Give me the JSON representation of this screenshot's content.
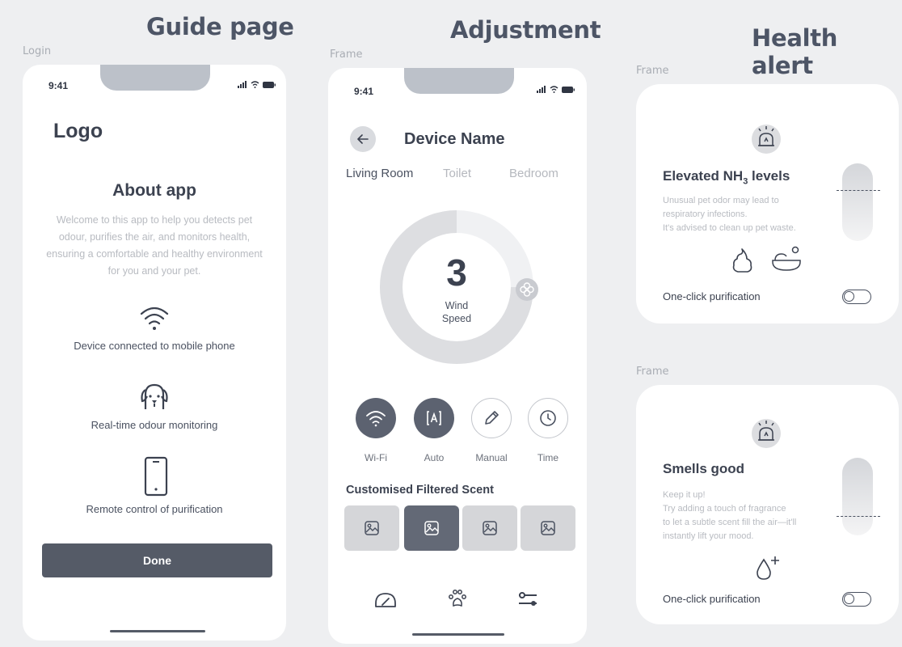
{
  "sections": {
    "guide_title": "Guide page",
    "adjust_title": "Adjustment",
    "health_title": "Health alert"
  },
  "frame_labels": {
    "login": "Login",
    "frame1": "Frame",
    "frame2": "Frame",
    "frame3": "Frame"
  },
  "guide": {
    "time": "9:41",
    "logo": "Logo",
    "about_title": "About app",
    "about_text": "Welcome to this app to help you detects pet odour, purifies the air, and monitors health, ensuring a comfortable and healthy environment for you and your pet.",
    "features": [
      {
        "icon": "wifi-icon",
        "label": "Device connected to mobile phone"
      },
      {
        "icon": "dog-face-icon",
        "label": "Real-time odour monitoring"
      },
      {
        "icon": "phone-icon",
        "label": "Remote control of purification"
      }
    ],
    "done_label": "Done"
  },
  "adjust": {
    "time": "9:41",
    "device_name": "Device Name",
    "rooms": [
      "Living Room",
      "Toilet",
      "Bedroom"
    ],
    "wind_speed_value": "3",
    "wind_label_line1": "Wind",
    "wind_label_line2": "Speed",
    "modes": [
      {
        "label": "Wi-Fi",
        "icon": "wifi-icon",
        "active": true
      },
      {
        "label": "Auto",
        "icon": "auto-icon",
        "active": true
      },
      {
        "label": "Manual",
        "icon": "pencil-icon",
        "active": false
      },
      {
        "label": "Time",
        "icon": "clock-icon",
        "active": false
      }
    ],
    "scent_title": "Customised Filtered Scent",
    "scents_selected_index": 1,
    "nav_icons": [
      "gauge-icon",
      "paw-icon",
      "sliders-icon"
    ]
  },
  "health": {
    "card1": {
      "title": "Elevated NH",
      "title_sub": "3",
      "title_suffix": " levels",
      "line1": "Unusual pet odor may lead to",
      "line2": "respiratory infections.",
      "line3": "It's advised to clean up pet waste.",
      "toggle_label": "One-click purification"
    },
    "card2": {
      "title": "Smells good",
      "line1": "Keep it up!",
      "line2": "Try adding a touch of fragrance",
      "line3": "to let a subtle scent fill the air—it'll",
      "line4": "instantly lift your mood.",
      "toggle_label": "One-click purification"
    }
  },
  "colors": {
    "dark_button": "#555b67",
    "accent_gray": "#5c6270",
    "background": "#eeeff1"
  }
}
